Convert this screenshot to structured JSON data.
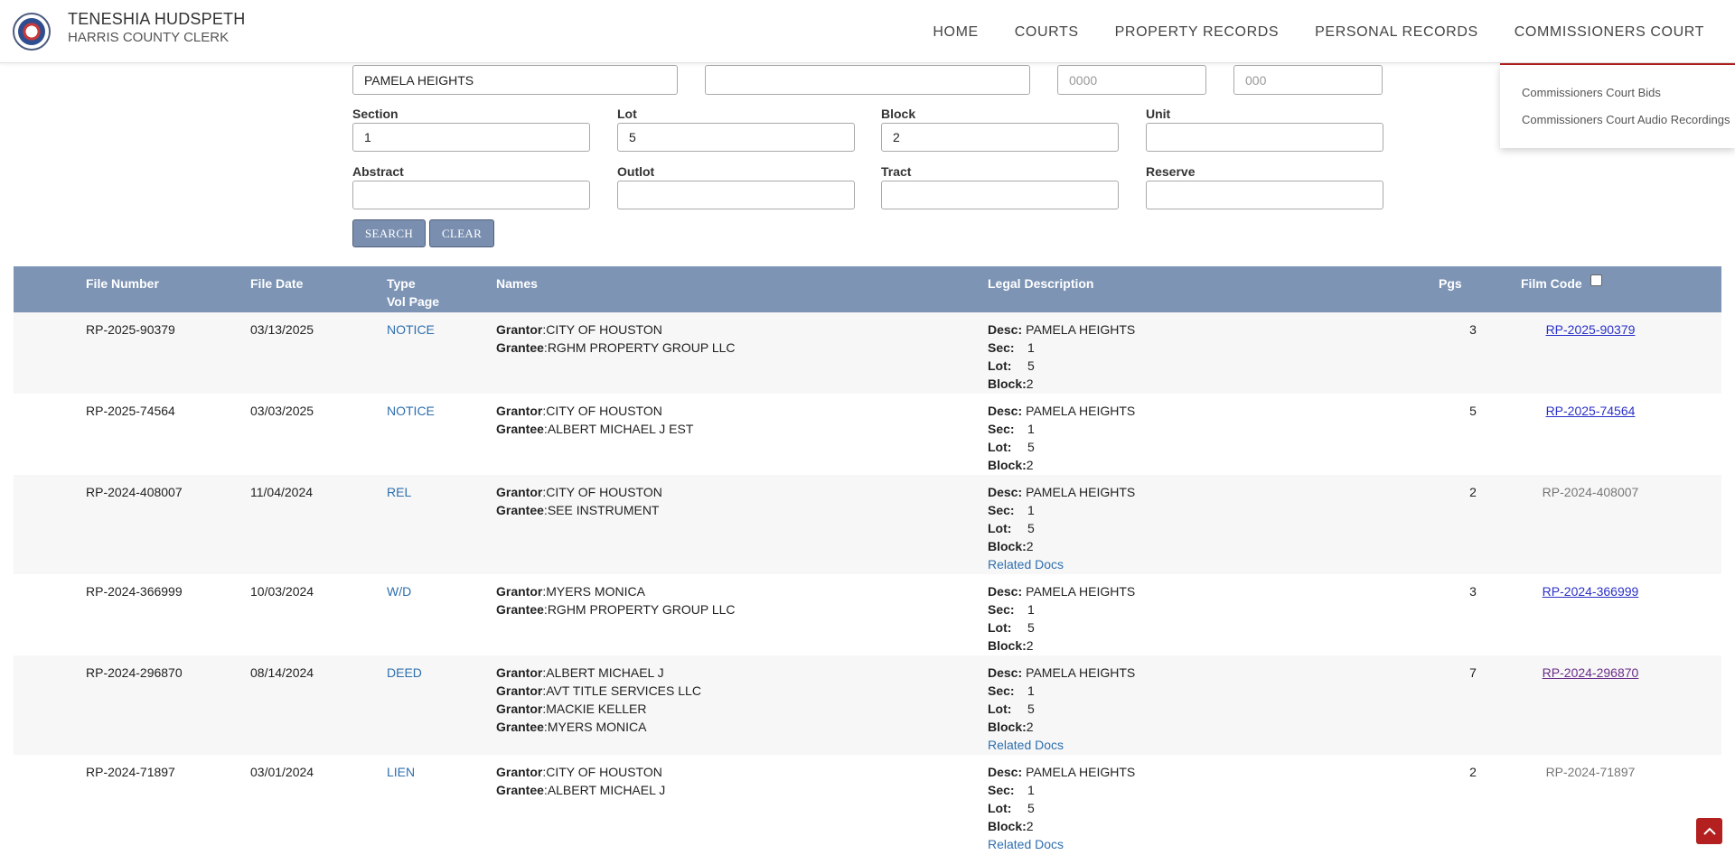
{
  "header": {
    "name": "TENESHIA HUDSPETH",
    "subtitle": "HARRIS COUNTY CLERK",
    "nav": [
      "HOME",
      "COURTS",
      "PROPERTY RECORDS",
      "PERSONAL RECORDS",
      "COMMISSIONERS COURT"
    ],
    "active_nav": "COMMISSIONERS COURT"
  },
  "dropdown": {
    "items": [
      "Commissioners Court Bids",
      "Commissioners Court Audio Recordings"
    ]
  },
  "form": {
    "subdivision_value": "PAMELA HEIGHTS",
    "field2_value": "",
    "field3_placeholder": "0000",
    "field4_placeholder": "000",
    "labels": {
      "section": "Section",
      "lot": "Lot",
      "block": "Block",
      "unit": "Unit",
      "abstract": "Abstract",
      "outlot": "Outlot",
      "tract": "Tract",
      "reserve": "Reserve"
    },
    "values": {
      "section": "1",
      "lot": "5",
      "block": "2",
      "unit": "",
      "abstract": "",
      "outlot": "",
      "tract": "",
      "reserve": ""
    },
    "buttons": {
      "search": "SEARCH",
      "clear": "CLEAR"
    }
  },
  "table": {
    "headers": {
      "file_number": "File Number",
      "file_date": "File Date",
      "type": "Type",
      "vol_page": "Vol Page",
      "names": "Names",
      "legal": "Legal Description",
      "pgs": "Pgs",
      "film_code": "Film Code"
    },
    "legal_keys": {
      "desc": "Desc:",
      "sec": "Sec:",
      "lot": "Lot:",
      "block": "Block:"
    },
    "related_label": "Related Docs",
    "rows": [
      {
        "file_number": "RP-2025-90379",
        "file_date": "03/13/2025",
        "type": "NOTICE",
        "parties": [
          [
            "Grantor",
            "CITY OF HOUSTON"
          ],
          [
            "Grantee",
            "RGHM PROPERTY GROUP LLC"
          ]
        ],
        "desc": "PAMELA HEIGHTS",
        "sec": "1",
        "lot": "5",
        "block": "2",
        "related": false,
        "pgs": "3",
        "film_code": "RP-2025-90379",
        "film_style": "link"
      },
      {
        "file_number": "RP-2025-74564",
        "file_date": "03/03/2025",
        "type": "NOTICE",
        "parties": [
          [
            "Grantor",
            "CITY OF HOUSTON"
          ],
          [
            "Grantee",
            "ALBERT MICHAEL J EST"
          ]
        ],
        "desc": "PAMELA HEIGHTS",
        "sec": "1",
        "lot": "5",
        "block": "2",
        "related": false,
        "pgs": "5",
        "film_code": "RP-2025-74564",
        "film_style": "link"
      },
      {
        "file_number": "RP-2024-408007",
        "file_date": "11/04/2024",
        "type": "REL",
        "parties": [
          [
            "Grantor",
            "CITY OF HOUSTON"
          ],
          [
            "Grantee",
            "SEE INSTRUMENT"
          ]
        ],
        "desc": "PAMELA HEIGHTS",
        "sec": "1",
        "lot": "5",
        "block": "2",
        "related": true,
        "pgs": "2",
        "film_code": "RP-2024-408007",
        "film_style": "plain"
      },
      {
        "file_number": "RP-2024-366999",
        "file_date": "10/03/2024",
        "type": "W/D",
        "parties": [
          [
            "Grantor",
            "MYERS MONICA"
          ],
          [
            "Grantee",
            "RGHM PROPERTY GROUP LLC"
          ]
        ],
        "desc": "PAMELA HEIGHTS",
        "sec": "1",
        "lot": "5",
        "block": "2",
        "related": false,
        "pgs": "3",
        "film_code": "RP-2024-366999",
        "film_style": "link"
      },
      {
        "file_number": "RP-2024-296870",
        "file_date": "08/14/2024",
        "type": "DEED",
        "parties": [
          [
            "Grantor",
            "ALBERT MICHAEL J"
          ],
          [
            "Grantor",
            "AVT TITLE SERVICES LLC"
          ],
          [
            "Grantor",
            "MACKIE KELLER"
          ],
          [
            "Grantee",
            "MYERS MONICA"
          ]
        ],
        "desc": "PAMELA HEIGHTS",
        "sec": "1",
        "lot": "5",
        "block": "2",
        "related": true,
        "pgs": "7",
        "film_code": "RP-2024-296870",
        "film_style": "visited"
      },
      {
        "file_number": "RP-2024-71897",
        "file_date": "03/01/2024",
        "type": "LIEN",
        "parties": [
          [
            "Grantor",
            "CITY OF HOUSTON"
          ],
          [
            "Grantee",
            "ALBERT MICHAEL J"
          ]
        ],
        "desc": "PAMELA HEIGHTS",
        "sec": "1",
        "lot": "5",
        "block": "2",
        "related": true,
        "pgs": "2",
        "film_code": "RP-2024-71897",
        "film_style": "plain"
      }
    ]
  },
  "colors": {
    "accent_red": "#b3201f",
    "table_header": "#7d94b5",
    "button": "#7a8fb0",
    "link": "#2e6fae"
  },
  "icons": {
    "scroll_top": "chevron-up-icon",
    "logo": "county-seal-icon"
  }
}
